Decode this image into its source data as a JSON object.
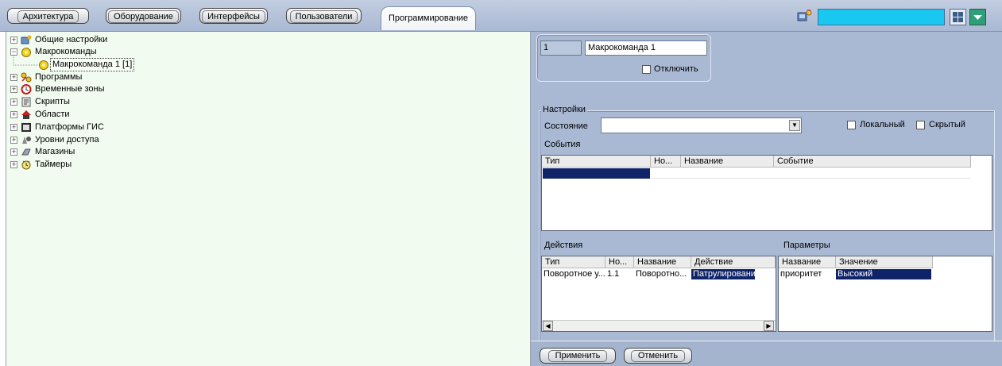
{
  "tabs": [
    {
      "label": "Архитектура",
      "active": false
    },
    {
      "label": "Оборудование",
      "active": false
    },
    {
      "label": "Интерфейсы",
      "active": false
    },
    {
      "label": "Пользователи",
      "active": false
    },
    {
      "label": "Программирование",
      "active": true
    }
  ],
  "toolbar": {
    "search_value": ""
  },
  "tree": {
    "items": [
      {
        "label": "Общие настройки",
        "icon": "settings-icon",
        "expander": "+"
      },
      {
        "label": "Макрокоманды",
        "icon": "macro-icon",
        "expander": "−"
      },
      {
        "label": "Макрокоманда 1 [1]",
        "icon": "macro-icon",
        "expander": "",
        "selected": true
      },
      {
        "label": "Программы",
        "icon": "programs-icon",
        "expander": "+"
      },
      {
        "label": "Временные зоны",
        "icon": "clock-icon",
        "expander": "+"
      },
      {
        "label": "Скрипты",
        "icon": "script-icon",
        "expander": "+"
      },
      {
        "label": "Области",
        "icon": "house-icon",
        "expander": "+"
      },
      {
        "label": "Платформы ГИС",
        "icon": "gis-icon",
        "expander": "+"
      },
      {
        "label": "Уровни доступа",
        "icon": "access-icon",
        "expander": "+"
      },
      {
        "label": "Магазины",
        "icon": "shop-icon",
        "expander": "+"
      },
      {
        "label": "Таймеры",
        "icon": "timer-icon",
        "expander": "+"
      }
    ]
  },
  "object": {
    "id": "1",
    "name": "Макрокоманда 1",
    "disable_label": "Отключить"
  },
  "settings": {
    "group_label": "Настройки",
    "state_label": "Состояние",
    "state_value": "",
    "local_label": "Локальный",
    "hidden_label": "Скрытый",
    "events_label": "События",
    "events_headers": [
      "Тип",
      "Но...",
      "Название",
      "Событие"
    ],
    "actions_label": "Действия",
    "actions_headers": [
      "Тип",
      "Но...",
      "Название",
      "Действие"
    ],
    "actions_row": [
      "Поворотное у...",
      "1.1",
      "Поворотно...",
      "Патрулирование"
    ],
    "params_label": "Параметры",
    "params_headers": [
      "Название",
      "Значение"
    ],
    "params_row": [
      "приоритет",
      "Высокий"
    ]
  },
  "buttons": {
    "apply": "Применить",
    "cancel": "Отменить"
  },
  "colors": {
    "panel_bg": "#a9b8d3",
    "tree_bg": "#f1fbef",
    "selection": "#0f2468",
    "accent_field": "#18c8f0"
  }
}
